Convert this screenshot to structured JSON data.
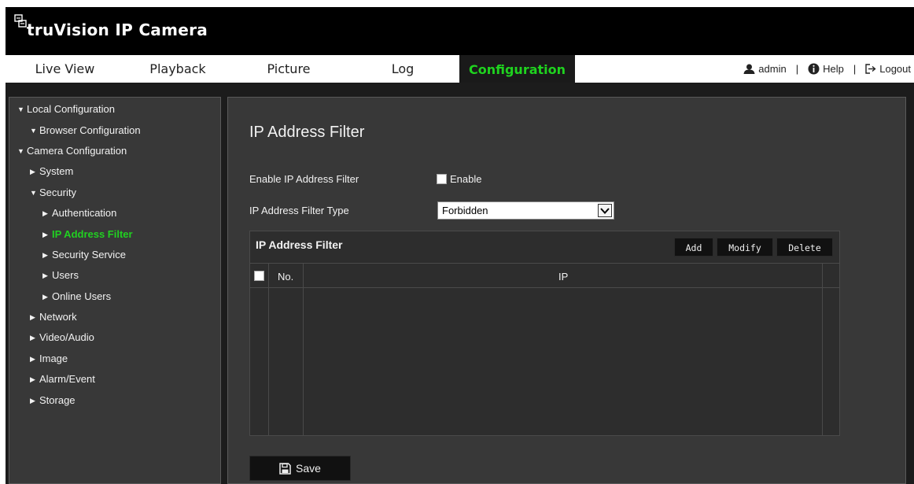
{
  "app": {
    "brand": "truVision",
    "product": "IP Camera",
    "logo_icon": "camera-logo-icon"
  },
  "nav": {
    "tabs": [
      {
        "label": "Live View"
      },
      {
        "label": "Playback"
      },
      {
        "label": "Picture"
      },
      {
        "label": "Log"
      },
      {
        "label": "Configuration",
        "active": true
      }
    ],
    "user": {
      "label": "admin",
      "icon": "user-icon"
    },
    "help": {
      "label": "Help",
      "icon": "info-icon"
    },
    "logout": {
      "label": "Logout",
      "icon": "logout-icon"
    },
    "separator": "|"
  },
  "sidebar": {
    "items": [
      {
        "label": "Local Configuration",
        "arrow": "▼"
      },
      {
        "label": "Browser Configuration",
        "arrow": "▼"
      },
      {
        "label": "Camera Configuration",
        "arrow": "▼"
      },
      {
        "label": "System",
        "arrow": "▶"
      },
      {
        "label": "Security",
        "arrow": "▼"
      },
      {
        "label": "Authentication",
        "arrow": "▶"
      },
      {
        "label": "IP Address Filter",
        "arrow": "▶",
        "active": true
      },
      {
        "label": "Security Service",
        "arrow": "▶"
      },
      {
        "label": "Users",
        "arrow": "▶"
      },
      {
        "label": "Online Users",
        "arrow": "▶"
      },
      {
        "label": "Network",
        "arrow": "▶"
      },
      {
        "label": "Video/Audio",
        "arrow": "▶"
      },
      {
        "label": "Image",
        "arrow": "▶"
      },
      {
        "label": "Alarm/Event",
        "arrow": "▶"
      },
      {
        "label": "Storage",
        "arrow": "▶"
      }
    ]
  },
  "main": {
    "title": "IP Address Filter",
    "enable_label": "Enable IP Address Filter",
    "enable_checkbox_label": "Enable",
    "enable_checked": false,
    "filter_type_label": "IP Address Filter Type",
    "filter_type_value": "Forbidden",
    "table": {
      "title": "IP Address Filter",
      "buttons": {
        "add": "Add",
        "modify": "Modify",
        "delete": "Delete"
      },
      "columns": [
        "No.",
        "IP"
      ],
      "rows": []
    },
    "save_label": "Save"
  },
  "colors": {
    "accent": "#21d021",
    "panel": "#383838",
    "background": "#1c1c1c"
  }
}
